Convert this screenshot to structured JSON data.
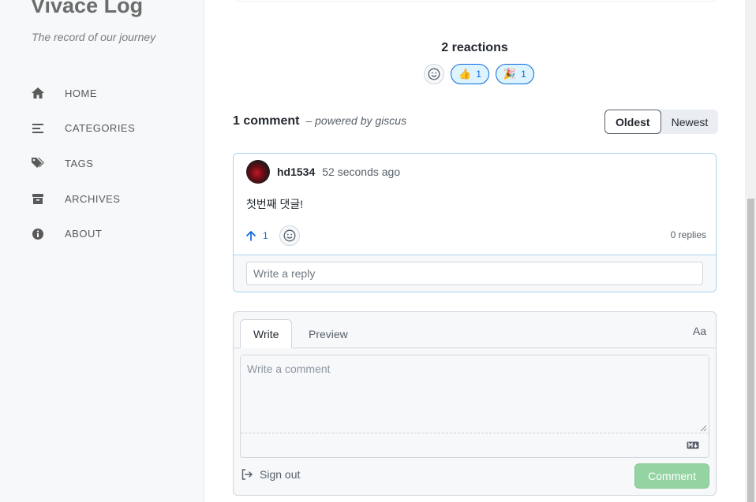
{
  "sidebar": {
    "site_title": "Vivace Log",
    "subtitle": "The record of our journey",
    "items": [
      {
        "label": "HOME",
        "icon": "home-icon"
      },
      {
        "label": "CATEGORIES",
        "icon": "list-icon"
      },
      {
        "label": "TAGS",
        "icon": "tags-icon"
      },
      {
        "label": "ARCHIVES",
        "icon": "archive-icon"
      },
      {
        "label": "ABOUT",
        "icon": "info-icon"
      }
    ]
  },
  "reactions": {
    "title": "2 reactions",
    "items": [
      {
        "emoji": "👍",
        "count": "1"
      },
      {
        "emoji": "🎉",
        "count": "1"
      }
    ]
  },
  "comments": {
    "count_label": "1 comment",
    "powered_by": "– powered by giscus",
    "sort_oldest": "Oldest",
    "sort_newest": "Newest",
    "active_sort": "Oldest"
  },
  "comment": {
    "author": "hd1534",
    "time_ago": "52 seconds ago",
    "body": "첫번째 댓글!",
    "upvotes": "1",
    "replies": "0 replies",
    "reply_placeholder": "Write a reply"
  },
  "editor": {
    "tab_write": "Write",
    "tab_preview": "Preview",
    "aa_label": "Aa",
    "placeholder": "Write a comment",
    "sign_out": "Sign out",
    "submit": "Comment"
  },
  "colors": {
    "accent_blue": "#0969da",
    "comment_button": "#94d3a2",
    "card_border": "#a8d6f0"
  }
}
